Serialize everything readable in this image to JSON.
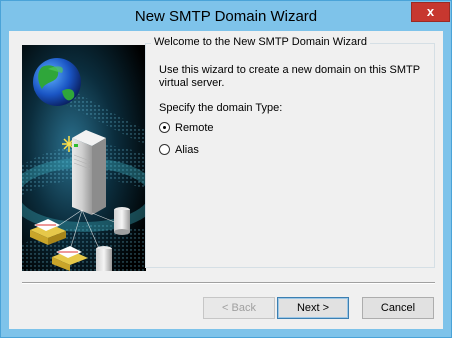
{
  "window": {
    "title": "New SMTP Domain Wizard",
    "close_symbol": "x"
  },
  "wizard": {
    "group_title": "Welcome to the New SMTP Domain Wizard",
    "description": "Use this wizard to create a new domain on this SMTP virtual server.",
    "specify_label": "Specify the domain Type:",
    "options": [
      {
        "label": "Remote",
        "selected": true
      },
      {
        "label": "Alias",
        "selected": false
      }
    ]
  },
  "buttons": {
    "back": "< Back",
    "next": "Next >",
    "cancel": "Cancel"
  },
  "colors": {
    "titlebar": "#7ec3ea",
    "close_button": "#c7372f",
    "panel_background": "#f0f0f0"
  },
  "icons": {
    "close": "close-icon",
    "illustration": "globe-server-mail-illustration"
  }
}
